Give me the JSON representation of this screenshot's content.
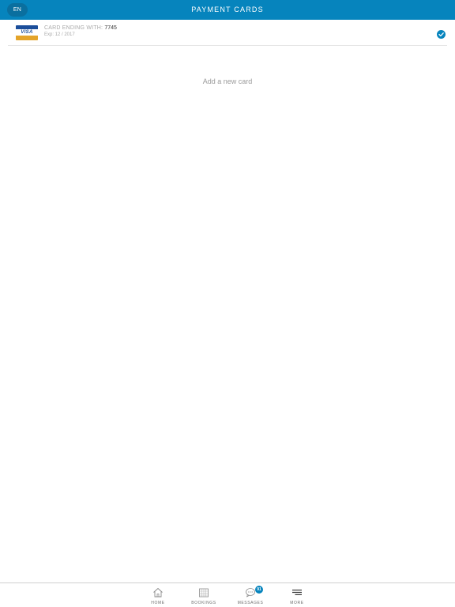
{
  "header": {
    "language": "EN",
    "title": "PAYMENT CARDS"
  },
  "card": {
    "label": "CARD ENDING WITH: ",
    "last_digits": "7745",
    "expiry": "Exp: 12 / 2017",
    "brand": "VISA",
    "selected": true,
    "colors": {
      "brand_blue": "#1b4e9a",
      "brand_gold": "#e4a42a"
    }
  },
  "actions": {
    "add_card": "Add a new card"
  },
  "tabbar": {
    "items": [
      {
        "label": "HOME",
        "icon": "home-icon"
      },
      {
        "label": "BOOKINGS",
        "icon": "calendar-icon"
      },
      {
        "label": "MESSAGES",
        "icon": "chat-bubble-icon",
        "badge": "91"
      },
      {
        "label": "MORE",
        "icon": "menu-icon"
      }
    ]
  },
  "theme": {
    "accent": "#0684bd"
  }
}
